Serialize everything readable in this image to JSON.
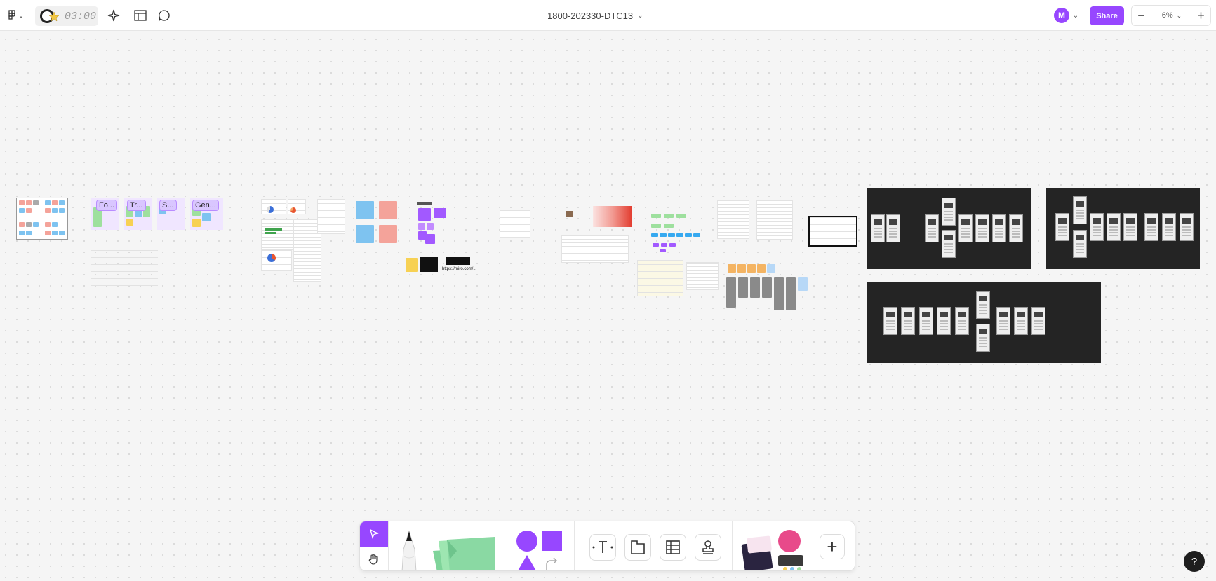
{
  "topbar": {
    "timer": "03:00",
    "file_title": "1800-202330-DTC13",
    "avatar_initial": "M",
    "share_label": "Share",
    "zoom_level": "6%",
    "zoom_minus": "−",
    "zoom_plus": "+"
  },
  "canvas": {
    "section_labels": [
      "Fo...",
      "Tr...",
      "S...",
      "Gen..."
    ],
    "link_text": "https://miro.com/...",
    "colors": {
      "sticky_pink": "#f4a39a",
      "sticky_blue": "#7ec3f0",
      "sticky_green": "#9ee09e",
      "sticky_yellow": "#f7d154",
      "sticky_purple": "#a259ff",
      "wireframe_bg": "#242424"
    }
  },
  "toolbar": {
    "move_icon": "cursor-icon",
    "hand_icon": "hand-icon",
    "text_icon": "text-icon",
    "section_icon": "section-icon",
    "table_icon": "table-icon",
    "stamp_icon": "stamp-icon",
    "widgets_label": "widgets",
    "add_label": "+"
  },
  "help_label": "?",
  "accent": "#9747ff"
}
